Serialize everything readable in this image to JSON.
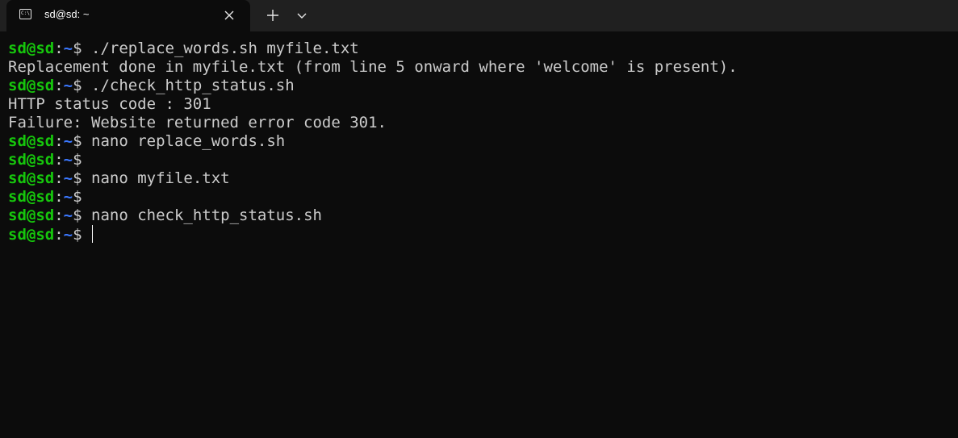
{
  "tab": {
    "title": "sd@sd: ~",
    "icon": "terminal-icon"
  },
  "titlebar": {
    "close_icon": "close-icon",
    "new_tab_icon": "plus-icon",
    "dropdown_icon": "chevron-down-icon"
  },
  "terminal": {
    "prompt": {
      "user_host": "sd@sd",
      "colon": ":",
      "path": "~",
      "symbol": "$"
    },
    "lines": [
      {
        "type": "command",
        "text": " ./replace_words.sh myfile.txt"
      },
      {
        "type": "output",
        "text": "Replacement done in myfile.txt (from line 5 onward where 'welcome' is present)."
      },
      {
        "type": "command",
        "text": " ./check_http_status.sh"
      },
      {
        "type": "output",
        "text": "HTTP status code : 301"
      },
      {
        "type": "output",
        "text": "Failure: Website returned error code 301."
      },
      {
        "type": "command",
        "text": " nano replace_words.sh"
      },
      {
        "type": "command",
        "text": ""
      },
      {
        "type": "command",
        "text": " nano myfile.txt"
      },
      {
        "type": "command",
        "text": ""
      },
      {
        "type": "command",
        "text": " nano check_http_status.sh"
      },
      {
        "type": "command",
        "text": " ",
        "cursor": true
      }
    ]
  },
  "colors": {
    "background": "#0c0c0c",
    "titlebar": "#202020",
    "prompt_user": "#16c60c",
    "prompt_path": "#3b78ff",
    "text": "#cccccc"
  }
}
